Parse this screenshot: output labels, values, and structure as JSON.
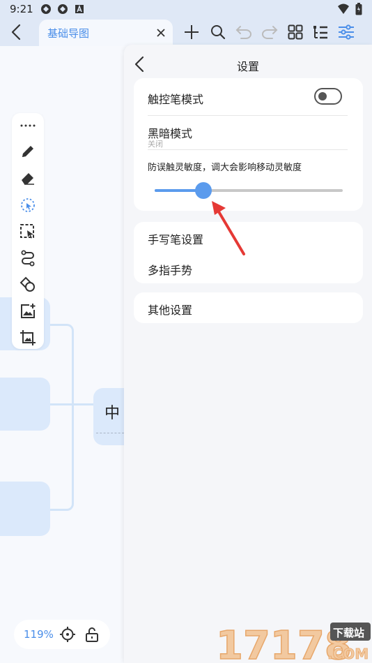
{
  "status_bar": {
    "time": "9:21"
  },
  "tab": {
    "label": "基础导图"
  },
  "toolbar": {
    "icons": [
      "back-icon",
      "close-icon",
      "plus-icon",
      "search-icon",
      "undo-icon",
      "redo-icon",
      "grid-icon",
      "outline-icon",
      "settings-sliders-icon"
    ]
  },
  "canvas": {
    "center_node_text": "中",
    "zoom_level": "119%"
  },
  "settings": {
    "title": "设置",
    "stylus_mode": {
      "label": "触控笔模式",
      "enabled": false
    },
    "dark_mode": {
      "label": "黑暗模式",
      "value": "关闭"
    },
    "sensitivity": {
      "label": "防误触灵敏度，调大会影响移动灵敏度",
      "value": 0.26
    },
    "items": [
      {
        "label": "手写笔设置"
      },
      {
        "label": "多指手势"
      },
      {
        "label": "其他设置"
      }
    ]
  },
  "watermark": {
    "text": "17178",
    "site": "下载站",
    "suffix": ".COM"
  },
  "colors": {
    "accent": "#4a8ee9",
    "slider": "#5b9bed",
    "node": "#dbe9fb",
    "arrow": "#e53935"
  }
}
